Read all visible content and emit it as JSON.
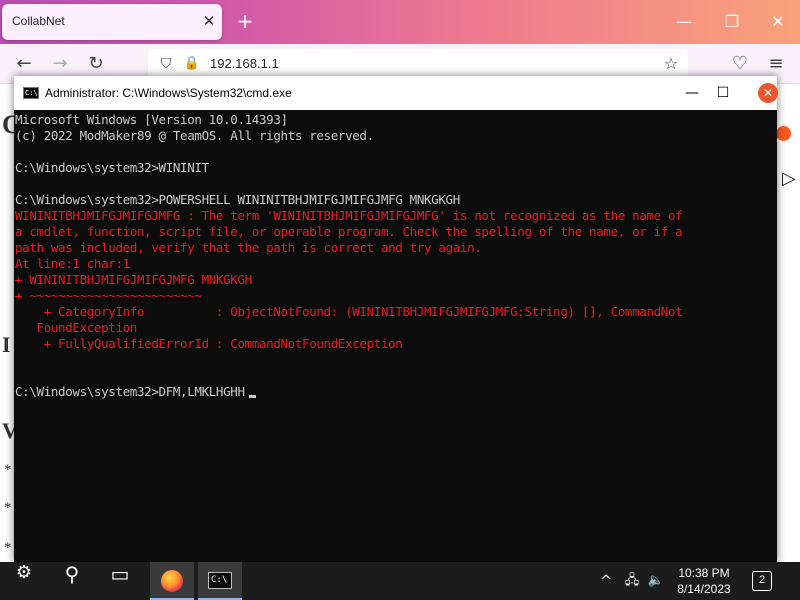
{
  "browser": {
    "tab_title": "CollabNet",
    "tab_close_glyph": "✕",
    "new_tab_glyph": "+",
    "url": "192.168.1.1",
    "controls": {
      "minimize": "—",
      "maximize": "❐",
      "close": "✕"
    },
    "nav": {
      "back": "←",
      "forward": "→",
      "reload": "↻",
      "shield": "⛉",
      "lock": "🔒",
      "star": "☆",
      "pocket": "♡",
      "menu": "≡"
    },
    "page_fragments": [
      "C",
      "I",
      "V",
      "*",
      "*",
      "*"
    ]
  },
  "cmd": {
    "title": "Administrator: C:\\Windows\\System32\\cmd.exe",
    "icon_text": "C:\\",
    "controls": {
      "minimize": "—",
      "maximize": "☐",
      "close": "✕"
    },
    "lines": [
      {
        "text": "Microsoft Windows [Version 10.0.14393]",
        "color": "white"
      },
      {
        "text": "(c) 2022 ModMaker89 @ TeamOS. All rights reserved.",
        "color": "white"
      },
      {
        "text": "",
        "color": "white"
      },
      {
        "text": "C:\\Windows\\system32>WININIT",
        "color": "white"
      },
      {
        "text": "",
        "color": "white"
      },
      {
        "text": "C:\\Windows\\system32>POWERSHELL WININITBHJMIFGJMIFGJMFG MNKGKGH",
        "color": "white"
      },
      {
        "text": "WININITBHJMIFGJMIFGJMFG : The term 'WININITBHJMIFGJMIFGJMFG' is not recognized as the name of",
        "color": "red"
      },
      {
        "text": "a cmdlet, function, script file, or operable program. Check the spelling of the name, or if a",
        "color": "red"
      },
      {
        "text": "path was included, verify that the path is correct and try again.",
        "color": "red"
      },
      {
        "text": "At line:1 char:1",
        "color": "red"
      },
      {
        "text": "+ WININITBHJMIFGJMIFGJMFG MNKGKGH",
        "color": "red"
      },
      {
        "text": "+ ~~~~~~~~~~~~~~~~~~~~~~~~",
        "color": "red"
      },
      {
        "text": "    + CategoryInfo          : ObjectNotFound: (WININITBHJMIFGJMIFGJMFG:String) [], CommandNot",
        "color": "red"
      },
      {
        "text": "   FoundException",
        "color": "red"
      },
      {
        "text": "    + FullyQualifiedErrorId : CommandNotFoundException",
        "color": "red"
      },
      {
        "text": "",
        "color": "white"
      },
      {
        "text": "",
        "color": "white"
      },
      {
        "text": "C:\\Windows\\system32>DFM,LMKLHGHH",
        "color": "white",
        "cursor": true
      }
    ]
  },
  "taskbar": {
    "start_glyph": "⚙",
    "search_glyph": "⚲",
    "taskview_glyph": "▭",
    "cmd_icon_text": "C:\\",
    "tray": {
      "chevron": "^",
      "network": "🖧",
      "volume": "🔈"
    },
    "time": "10:38 PM",
    "date": "8/14/2023",
    "notifications": "2"
  }
}
